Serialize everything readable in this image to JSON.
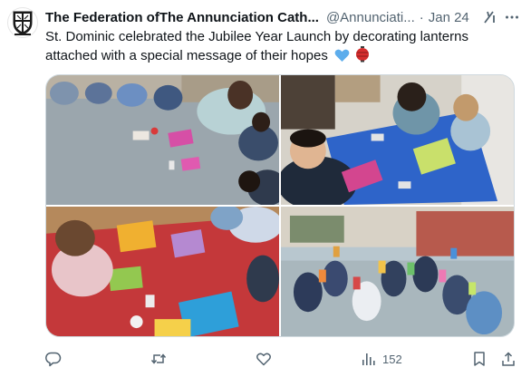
{
  "author": {
    "name": "The Federation ofThe Annunciation Cath...",
    "handle": "@Annunciati...",
    "separator": "·",
    "date": "Jan 24"
  },
  "tweet": {
    "text": "St. Dominic celebrated the Jubilee Year Launch by decorating lanterns attached with a special message of their hopes"
  },
  "stats": {
    "views": "152"
  },
  "icons": {
    "avatar": "school-crest-icon",
    "grok": "grok-icon",
    "more": "more-icon",
    "reply": "reply-icon",
    "retweet": "retweet-icon",
    "like": "like-icon",
    "views": "views-icon",
    "bookmark": "bookmark-icon",
    "share": "share-icon",
    "emoji_heart": "blue-heart-icon",
    "emoji_lantern": "lantern-icon"
  },
  "colors": {
    "text": "#0f1419",
    "secondary": "#536471",
    "border": "#cfd9de",
    "heart_emoji": "#5dadec",
    "lantern_emoji": "#d62d2d"
  }
}
